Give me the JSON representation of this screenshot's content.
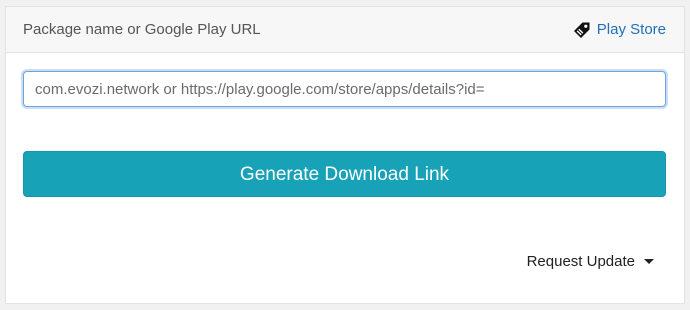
{
  "header": {
    "label": "Package name or Google Play URL",
    "store_link": {
      "label": "Play Store",
      "icon": "tag-link-icon"
    }
  },
  "search": {
    "value": "",
    "placeholder": "com.evozi.network or https://play.google.com/store/apps/details?id="
  },
  "actions": {
    "generate_label": "Generate Download Link",
    "request_update_label": "Request Update",
    "request_update_icon": "caret-down-icon"
  },
  "colors": {
    "page_background": "#f1f1f1",
    "header_background": "#f7f7f7",
    "button_accent": "#17a2b8",
    "link": "#1f70b8",
    "input_focus_border": "#6fa3dc"
  }
}
